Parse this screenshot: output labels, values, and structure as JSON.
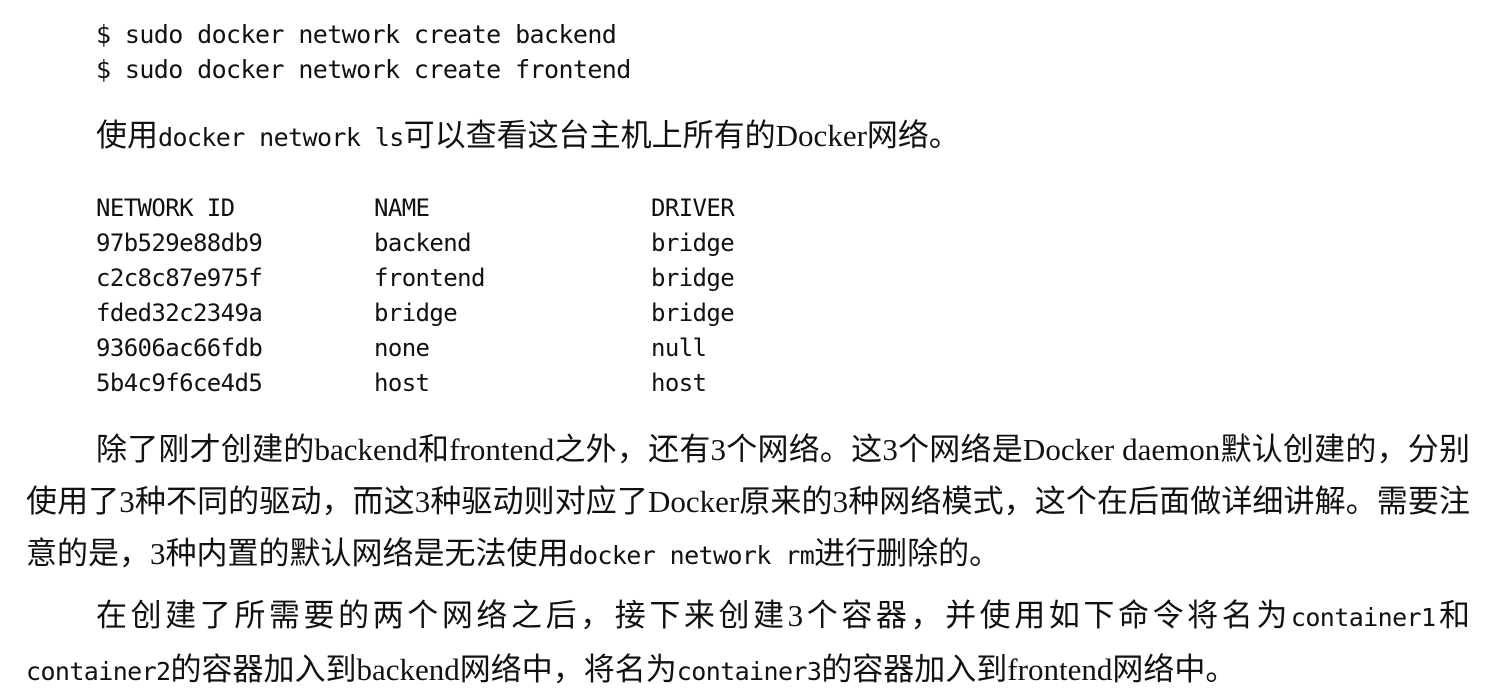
{
  "commands": [
    "$ sudo docker network create backend",
    "$ sudo docker network create frontend"
  ],
  "intro": {
    "before": "使用",
    "code": "docker network ls",
    "after": "可以查看这台主机上所有的Docker网络。"
  },
  "network_table": {
    "headers": [
      "NETWORK ID",
      "NAME",
      "DRIVER"
    ],
    "rows": [
      [
        "97b529e88db9",
        "backend",
        "bridge"
      ],
      [
        "c2c8c87e975f",
        "frontend",
        "bridge"
      ],
      [
        "fded32c2349a",
        "bridge",
        "bridge"
      ],
      [
        "93606ac66fdb",
        "none",
        "null"
      ],
      [
        "5b4c9f6ce4d5",
        "host",
        "host"
      ]
    ]
  },
  "para_defaults": {
    "text": "除了刚才创建的backend和frontend之外，还有3个网络。这3个网络是Docker daemon默认创建的，分别使用了3种不同的驱动，而这3种驱动则对应了Docker原来的3种网络模式，这个在后面做详细讲解。需要注意的是，3种内置的默认网络是无法使用",
    "code": "docker network rm",
    "after": "进行删除的。"
  },
  "para_containers": {
    "part1": "在创建了所需要的两个网络之后，接下来创建3个容器，并使用如下命令将名为",
    "code1": "container1",
    "part2": "和",
    "code2": "container2",
    "part3": "的容器加入到backend网络中，将名为",
    "code3": "container3",
    "part4": "的容器加入到frontend网络中。"
  }
}
